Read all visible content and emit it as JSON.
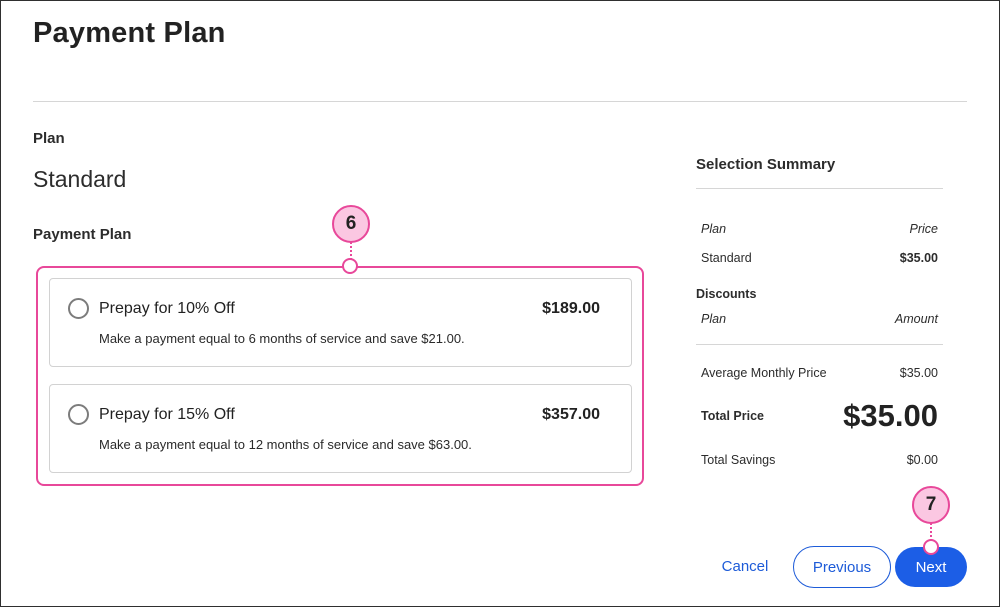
{
  "page": {
    "title": "Payment Plan"
  },
  "plan": {
    "label": "Plan",
    "value": "Standard"
  },
  "payment_plan": {
    "label": "Payment Plan",
    "options": [
      {
        "title": "Prepay for 10% Off",
        "price": "$189.00",
        "description": "Make a payment equal to 6 months of service and save $21.00."
      },
      {
        "title": "Prepay for 15% Off",
        "price": "$357.00",
        "description": "Make a payment equal to 12 months of service and save $63.00."
      }
    ]
  },
  "callouts": {
    "step6": "6",
    "step7": "7"
  },
  "summary": {
    "title": "Selection Summary",
    "plan_header": "Plan",
    "price_header": "Price",
    "plan_name": "Standard",
    "plan_price": "$35.00",
    "discounts_label": "Discounts",
    "discount_plan_header": "Plan",
    "discount_amount_header": "Amount",
    "avg_monthly_label": "Average Monthly Price",
    "avg_monthly_value": "$35.00",
    "total_price_label": "Total Price",
    "total_price_value": "$35.00",
    "total_savings_label": "Total Savings",
    "total_savings_value": "$0.00"
  },
  "actions": {
    "cancel": "Cancel",
    "previous": "Previous",
    "next": "Next"
  },
  "colors": {
    "accent_blue": "#1c5ee6",
    "callout_pink": "#e8489a",
    "callout_fill": "#fbc7e2"
  }
}
